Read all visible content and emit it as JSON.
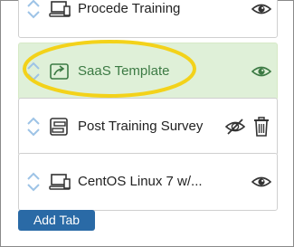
{
  "tabs": [
    {
      "title": "Procede Training",
      "type_icon": "monitor-icon",
      "visible": true,
      "selected": false,
      "deletable": false
    },
    {
      "title": "SaaS Template",
      "type_icon": "external-link-icon",
      "visible": true,
      "selected": true,
      "deletable": false
    },
    {
      "title": "Post Training Survey",
      "type_icon": "form-icon",
      "visible": false,
      "selected": false,
      "deletable": true
    },
    {
      "title": "CentOS Linux 7 w/...",
      "type_icon": "monitor-icon",
      "visible": true,
      "selected": false,
      "deletable": false
    }
  ],
  "actions": {
    "add_tab_label": "Add Tab"
  },
  "colors": {
    "selected_background": "#dff0d8",
    "selected_text": "#3c7a44",
    "highlight_ring": "#f3d21a",
    "button": "#2a6aa6",
    "sort_arrows": "#9dc3e6"
  }
}
